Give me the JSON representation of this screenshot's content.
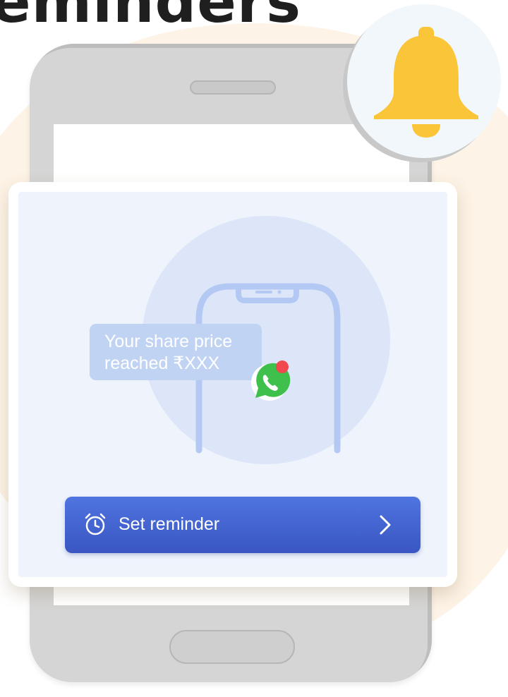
{
  "page": {
    "heading": "eminders"
  },
  "card": {
    "message_line1": "Your share price",
    "message_line2": "reached ₹XXX",
    "cta_label": "Set reminder"
  },
  "icons": {
    "bell": "bell-icon",
    "whatsapp": "whatsapp-icon",
    "clock": "alarm-clock-icon",
    "chevron": "chevron-right-icon"
  },
  "colors": {
    "bell": "#fbc53a",
    "cta_top": "#4f74e0",
    "cta_bottom": "#3a56c2",
    "whatsapp": "#3fbf4c",
    "notification_dot": "#f0484e",
    "background_blob": "#fdf3e6"
  }
}
